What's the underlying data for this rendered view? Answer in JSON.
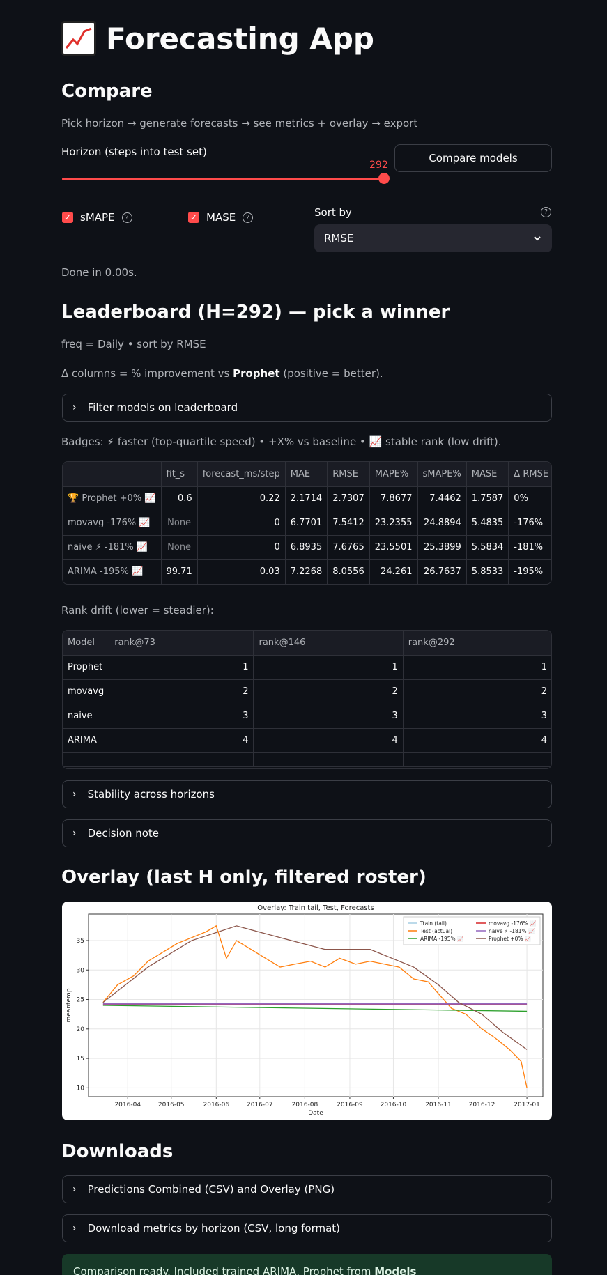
{
  "app": {
    "title": "Forecasting App",
    "icon": "chart-increasing-icon"
  },
  "compare": {
    "heading": "Compare",
    "caption": "Pick horizon → generate forecasts → see metrics + overlay → export",
    "slider_label": "Horizon (steps into test set)",
    "slider_value": "292",
    "slider_fraction": 1.0,
    "button_label": "Compare models",
    "smape_label": "sMAPE",
    "mase_label": "MASE",
    "sort_label": "Sort by",
    "sort_value": "RMSE",
    "done_text": "Done in 0.00s."
  },
  "leaderboard": {
    "heading": "Leaderboard (H=292) — pick a winner",
    "freq_line": "freq = Daily • sort by RMSE",
    "delta_pre": "Δ columns = % improvement vs ",
    "delta_bold": "Prophet",
    "delta_post": " (positive = better).",
    "filter_label": "Filter models on leaderboard",
    "badges_text": "Badges: ⚡ faster (top-quartile speed) • +X% vs baseline • 📈 stable rank (low drift).",
    "columns": [
      "",
      "fit_s",
      "forecast_ms/step",
      "MAE",
      "RMSE",
      "MAPE%",
      "sMAPE%",
      "MASE",
      "Δ RMSE vs Proph"
    ],
    "rows": [
      [
        "🏆 Prophet  +0% 📈",
        "0.6",
        "0.22",
        "2.1714",
        "2.7307",
        "7.8677",
        "7.4462",
        "1.7587",
        "0%"
      ],
      [
        "movavg  -176% 📈",
        "None",
        "0",
        "6.7701",
        "7.5412",
        "23.2355",
        "24.8894",
        "5.4835",
        "-176%"
      ],
      [
        "naive  ⚡ -181% 📈",
        "None",
        "0",
        "6.8935",
        "7.6765",
        "23.5501",
        "25.3899",
        "5.5834",
        "-181%"
      ],
      [
        "ARIMA  -195% 📈",
        "99.71",
        "0.03",
        "7.2268",
        "8.0556",
        "24.261",
        "26.7637",
        "5.8533",
        "-195%"
      ]
    ]
  },
  "rank_drift": {
    "caption": "Rank drift (lower = steadier):",
    "columns": [
      "Model",
      "rank@73",
      "rank@146",
      "rank@292"
    ],
    "rows": [
      [
        "Prophet",
        "1",
        "1",
        "1"
      ],
      [
        "movavg",
        "2",
        "2",
        "2"
      ],
      [
        "naive",
        "3",
        "3",
        "3"
      ],
      [
        "ARIMA",
        "4",
        "4",
        "4"
      ]
    ]
  },
  "expanders": {
    "stability": "Stability across horizons",
    "decision": "Decision note"
  },
  "overlay": {
    "heading": "Overlay (last H only, filtered roster)"
  },
  "chart_data": {
    "type": "line",
    "title": "Overlay: Train tail, Test, Forecasts",
    "xlabel": "Date",
    "ylabel": "meantemp",
    "x_ticks": [
      "2016-04",
      "2016-05",
      "2016-06",
      "2016-07",
      "2016-08",
      "2016-09",
      "2016-10",
      "2016-11",
      "2016-12",
      "2017-01"
    ],
    "y_ticks": [
      10,
      15,
      20,
      25,
      30,
      35
    ],
    "ylim": [
      8.5,
      39.5
    ],
    "grid": true,
    "legend_position": "top-right",
    "legend": [
      "Train (tail)",
      "Test (actual)",
      "ARIMA  -195% 📈",
      "movavg  -176% 📈",
      "naive  ⚡ -181% 📈",
      "Prophet  +0% 📈"
    ],
    "colors": {
      "train": "#a6cee3",
      "test": "#ff7f0e",
      "arima": "#2ca02c",
      "movavg": "#d62728",
      "naive": "#9467bd",
      "prophet": "#8c564b"
    },
    "series": [
      {
        "name": "Test (actual)",
        "x": [
          "2016-03-15",
          "2016-03-25",
          "2016-04-05",
          "2016-04-15",
          "2016-04-25",
          "2016-05-05",
          "2016-05-15",
          "2016-05-25",
          "2016-06-01",
          "2016-06-08",
          "2016-06-15",
          "2016-06-25",
          "2016-07-05",
          "2016-07-15",
          "2016-07-25",
          "2016-08-05",
          "2016-08-15",
          "2016-08-25",
          "2016-09-05",
          "2016-09-15",
          "2016-09-25",
          "2016-10-05",
          "2016-10-15",
          "2016-10-25",
          "2016-11-01",
          "2016-11-10",
          "2016-11-20",
          "2016-12-01",
          "2016-12-10",
          "2016-12-20",
          "2016-12-28",
          "2017-01-01"
        ],
        "values": [
          24.5,
          27.5,
          29.0,
          31.5,
          33.0,
          34.5,
          35.5,
          36.5,
          37.5,
          32.0,
          35.0,
          33.5,
          32.0,
          30.5,
          31.0,
          31.5,
          30.5,
          32.0,
          31.0,
          31.5,
          31.0,
          30.5,
          28.5,
          28.0,
          26.0,
          23.5,
          22.5,
          20.0,
          18.5,
          16.5,
          14.5,
          10.0
        ]
      },
      {
        "name": "ARIMA  -195% 📈",
        "x": [
          "2016-03-15",
          "2017-01-01"
        ],
        "values": [
          24.0,
          23.0
        ]
      },
      {
        "name": "movavg  -176% 📈",
        "x": [
          "2016-03-15",
          "2017-01-01"
        ],
        "values": [
          24.1,
          24.1
        ]
      },
      {
        "name": "naive  ⚡ -181% 📈",
        "x": [
          "2016-03-15",
          "2017-01-01"
        ],
        "values": [
          24.3,
          24.3
        ]
      },
      {
        "name": "Prophet  +0% 📈",
        "x": [
          "2016-03-15",
          "2016-04-15",
          "2016-05-15",
          "2016-06-15",
          "2016-07-15",
          "2016-08-15",
          "2016-09-15",
          "2016-10-15",
          "2016-11-01",
          "2016-11-15",
          "2016-12-01",
          "2016-12-15",
          "2017-01-01"
        ],
        "values": [
          24.5,
          30.5,
          35.0,
          37.5,
          35.5,
          33.5,
          33.5,
          30.5,
          27.5,
          24.5,
          22.5,
          19.5,
          16.5
        ]
      }
    ]
  },
  "downloads": {
    "heading": "Downloads",
    "predictions": "Predictions Combined (CSV) and Overlay (PNG)",
    "metrics": "Download metrics by horizon (CSV, long format)"
  },
  "success": {
    "text_pre": "Comparison ready. Included trained ARIMA, Prophet from ",
    "text_bold": "Models"
  }
}
